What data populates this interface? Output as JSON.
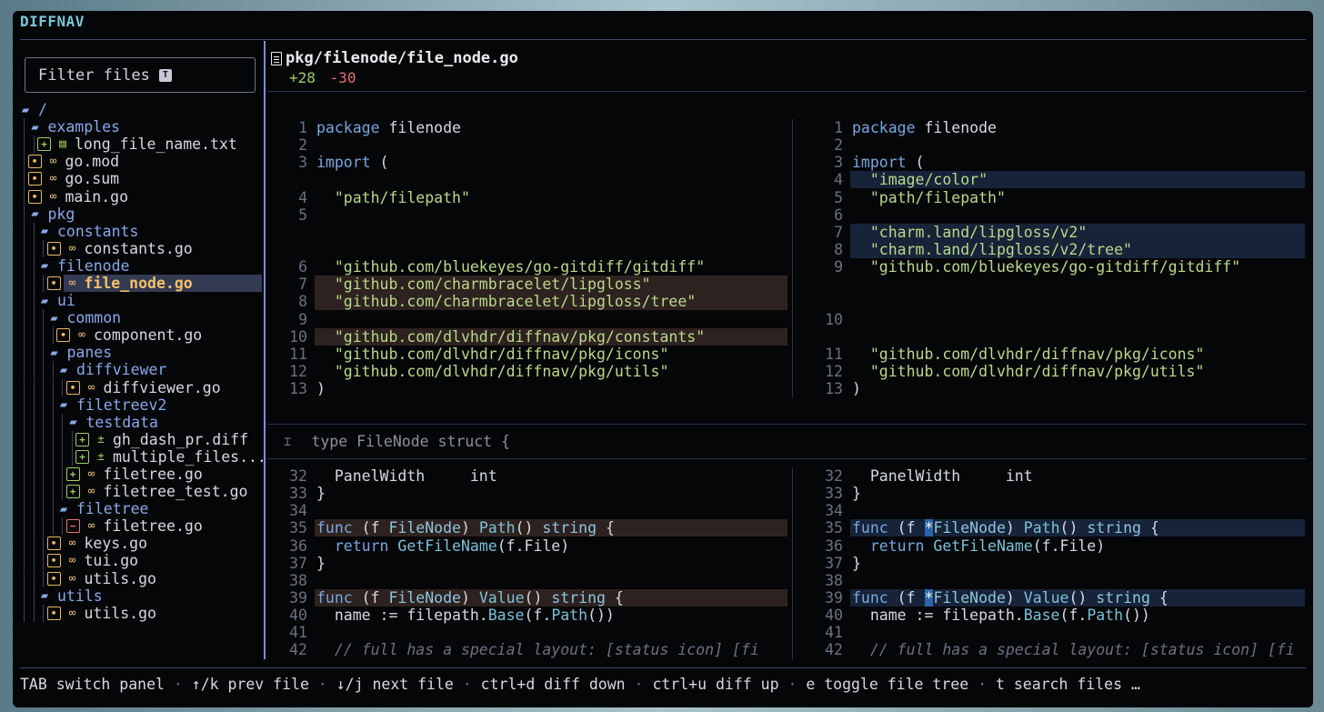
{
  "app": {
    "title": "DIFFNAV"
  },
  "sidebar": {
    "filter_label": "Filter files",
    "filter_key": "T",
    "tree": [
      {
        "depth": 0,
        "kind": "dir",
        "name": "/"
      },
      {
        "depth": 1,
        "kind": "dir",
        "name": "examples"
      },
      {
        "depth": 2,
        "kind": "file",
        "status": "add",
        "ftype": "txt",
        "name": "long_file_name.txt"
      },
      {
        "depth": 1,
        "kind": "file",
        "status": "mod",
        "ftype": "go",
        "name": "go.mod"
      },
      {
        "depth": 1,
        "kind": "file",
        "status": "mod",
        "ftype": "go",
        "name": "go.sum"
      },
      {
        "depth": 1,
        "kind": "file",
        "status": "mod",
        "ftype": "go",
        "name": "main.go"
      },
      {
        "depth": 1,
        "kind": "dir",
        "name": "pkg"
      },
      {
        "depth": 2,
        "kind": "dir",
        "name": "constants"
      },
      {
        "depth": 3,
        "kind": "file",
        "status": "mod",
        "ftype": "go",
        "name": "constants.go"
      },
      {
        "depth": 2,
        "kind": "dir",
        "name": "filenode"
      },
      {
        "depth": 3,
        "kind": "file",
        "status": "mod",
        "ftype": "go",
        "name": "file_node.go",
        "selected": true
      },
      {
        "depth": 2,
        "kind": "dir",
        "name": "ui"
      },
      {
        "depth": 3,
        "kind": "dir",
        "name": "common"
      },
      {
        "depth": 4,
        "kind": "file",
        "status": "mod",
        "ftype": "go",
        "name": "component.go"
      },
      {
        "depth": 3,
        "kind": "dir",
        "name": "panes"
      },
      {
        "depth": 4,
        "kind": "dir",
        "name": "diffviewer"
      },
      {
        "depth": 5,
        "kind": "file",
        "status": "mod",
        "ftype": "go",
        "name": "diffviewer.go"
      },
      {
        "depth": 4,
        "kind": "dir",
        "name": "filetreev2"
      },
      {
        "depth": 5,
        "kind": "dir",
        "name": "testdata"
      },
      {
        "depth": 6,
        "kind": "file",
        "status": "add",
        "ftype": "diff",
        "name": "gh_dash_pr.diff"
      },
      {
        "depth": 6,
        "kind": "file",
        "status": "add",
        "ftype": "diff",
        "name": "multiple_files..."
      },
      {
        "depth": 5,
        "kind": "file",
        "status": "add",
        "ftype": "go",
        "name": "filetree.go"
      },
      {
        "depth": 5,
        "kind": "file",
        "status": "add",
        "ftype": "go",
        "name": "filetree_test.go"
      },
      {
        "depth": 4,
        "kind": "dir",
        "name": "filetree"
      },
      {
        "depth": 5,
        "kind": "file",
        "status": "del",
        "ftype": "go",
        "name": "filetree.go"
      },
      {
        "depth": 3,
        "kind": "file",
        "status": "mod",
        "ftype": "go",
        "name": "keys.go"
      },
      {
        "depth": 3,
        "kind": "file",
        "status": "mod",
        "ftype": "go",
        "name": "tui.go"
      },
      {
        "depth": 3,
        "kind": "file",
        "status": "mod",
        "ftype": "go",
        "name": "utils.go"
      },
      {
        "depth": 2,
        "kind": "dir",
        "name": "utils"
      },
      {
        "depth": 3,
        "kind": "file",
        "status": "mod",
        "ftype": "go",
        "name": "utils.go"
      }
    ]
  },
  "file_header": {
    "path": "pkg/filenode/file_node.go",
    "additions": "+28",
    "deletions": "-30"
  },
  "hunk1": {
    "left": [
      {
        "n": "1",
        "t": [
          [
            "kw",
            "package"
          ],
          [
            "txt",
            " filenode"
          ]
        ]
      },
      {
        "n": "2",
        "t": []
      },
      {
        "n": "3",
        "t": [
          [
            "kw",
            "import"
          ],
          [
            "txt",
            " ("
          ]
        ]
      },
      {
        "n": "",
        "t": []
      },
      {
        "n": "4",
        "t": [
          [
            "str",
            "  \"path/filepath\""
          ]
        ]
      },
      {
        "n": "5",
        "t": []
      },
      {
        "n": "",
        "t": []
      },
      {
        "n": "",
        "t": []
      },
      {
        "n": "6",
        "t": [
          [
            "str",
            "  \"github.com/bluekeyes/go-gitdiff/gitdiff\""
          ]
        ]
      },
      {
        "n": "7",
        "bg": "del",
        "t": [
          [
            "str",
            "  \"github.com/charmbracelet/lipgloss\""
          ]
        ]
      },
      {
        "n": "8",
        "bg": "del",
        "t": [
          [
            "str",
            "  \"github.com/charmbracelet/lipgloss/tree\""
          ]
        ]
      },
      {
        "n": "9",
        "t": []
      },
      {
        "n": "10",
        "bg": "del",
        "t": [
          [
            "str",
            "  \"github.com/dlvhdr/diffnav/pkg/constants\""
          ]
        ]
      },
      {
        "n": "11",
        "t": [
          [
            "str",
            "  \"github.com/dlvhdr/diffnav/pkg/icons\""
          ]
        ]
      },
      {
        "n": "12",
        "t": [
          [
            "str",
            "  \"github.com/dlvhdr/diffnav/pkg/utils\""
          ]
        ]
      },
      {
        "n": "13",
        "t": [
          [
            "txt",
            ")"
          ]
        ]
      }
    ],
    "right": [
      {
        "n": "1",
        "t": [
          [
            "kw",
            "package"
          ],
          [
            "txt",
            " filenode"
          ]
        ]
      },
      {
        "n": "2",
        "t": []
      },
      {
        "n": "3",
        "t": [
          [
            "kw",
            "import"
          ],
          [
            "txt",
            " ("
          ]
        ]
      },
      {
        "n": "4",
        "bg": "add",
        "t": [
          [
            "str",
            "  \"image/color\""
          ]
        ]
      },
      {
        "n": "5",
        "t": [
          [
            "str",
            "  \"path/filepath\""
          ]
        ]
      },
      {
        "n": "6",
        "t": []
      },
      {
        "n": "7",
        "bg": "add",
        "t": [
          [
            "str",
            "  \"charm.land/lipgloss/v2\""
          ]
        ]
      },
      {
        "n": "8",
        "bg": "add",
        "t": [
          [
            "str",
            "  \"charm.land/lipgloss/v2/tree\""
          ]
        ]
      },
      {
        "n": "9",
        "t": [
          [
            "str",
            "  \"github.com/bluekeyes/go-gitdiff/gitdiff\""
          ]
        ]
      },
      {
        "n": "",
        "t": []
      },
      {
        "n": "",
        "t": []
      },
      {
        "n": "10",
        "t": []
      },
      {
        "n": "",
        "t": []
      },
      {
        "n": "11",
        "t": [
          [
            "str",
            "  \"github.com/dlvhdr/diffnav/pkg/icons\""
          ]
        ]
      },
      {
        "n": "12",
        "t": [
          [
            "str",
            "  \"github.com/dlvhdr/diffnav/pkg/utils\""
          ]
        ]
      },
      {
        "n": "13",
        "t": [
          [
            "txt",
            ")"
          ]
        ]
      }
    ]
  },
  "hunk_header": {
    "icon": "⌶",
    "text": "type FileNode struct {"
  },
  "hunk2": {
    "left": [
      {
        "n": "32",
        "t": [
          [
            "txt",
            "  PanelWidth     int"
          ]
        ]
      },
      {
        "n": "33",
        "t": [
          [
            "txt",
            "}"
          ]
        ]
      },
      {
        "n": "34",
        "t": []
      },
      {
        "n": "35",
        "bg": "del",
        "t": [
          [
            "kw",
            "func"
          ],
          [
            "txt",
            " (f "
          ],
          [
            "ty",
            "FileNode"
          ],
          [
            "txt",
            ") "
          ],
          [
            "fn",
            "Path"
          ],
          [
            "txt",
            "() "
          ],
          [
            "ty",
            "string"
          ],
          [
            "txt",
            " {"
          ]
        ]
      },
      {
        "n": "36",
        "t": [
          [
            "txt",
            "  "
          ],
          [
            "kw",
            "return"
          ],
          [
            "txt",
            " "
          ],
          [
            "fn",
            "GetFileName"
          ],
          [
            "txt",
            "(f.File)"
          ]
        ]
      },
      {
        "n": "37",
        "t": [
          [
            "txt",
            "}"
          ]
        ]
      },
      {
        "n": "38",
        "t": []
      },
      {
        "n": "39",
        "bg": "del",
        "t": [
          [
            "kw",
            "func"
          ],
          [
            "txt",
            " (f "
          ],
          [
            "ty",
            "FileNode"
          ],
          [
            "txt",
            ") "
          ],
          [
            "fn",
            "Value"
          ],
          [
            "txt",
            "() "
          ],
          [
            "ty",
            "string"
          ],
          [
            "txt",
            " {"
          ]
        ]
      },
      {
        "n": "40",
        "t": [
          [
            "txt",
            "  name := filepath."
          ],
          [
            "fn",
            "Base"
          ],
          [
            "txt",
            "(f."
          ],
          [
            "fn",
            "Path"
          ],
          [
            "txt",
            "())"
          ]
        ]
      },
      {
        "n": "41",
        "t": []
      },
      {
        "n": "42",
        "t": [
          [
            "cm",
            "  // full has a special layout: [status icon] [fi"
          ]
        ]
      }
    ],
    "right": [
      {
        "n": "32",
        "t": [
          [
            "txt",
            "  PanelWidth     int"
          ]
        ]
      },
      {
        "n": "33",
        "t": [
          [
            "txt",
            "}"
          ]
        ]
      },
      {
        "n": "34",
        "t": []
      },
      {
        "n": "35",
        "bg": "add",
        "t": [
          [
            "kw",
            "func"
          ],
          [
            "txt",
            " (f "
          ],
          [
            "hl",
            "*"
          ],
          [
            "ty",
            "FileNode"
          ],
          [
            "txt",
            ") "
          ],
          [
            "fn",
            "Path"
          ],
          [
            "txt",
            "() "
          ],
          [
            "ty",
            "string"
          ],
          [
            "txt",
            " {"
          ]
        ]
      },
      {
        "n": "36",
        "t": [
          [
            "txt",
            "  "
          ],
          [
            "kw",
            "return"
          ],
          [
            "txt",
            " "
          ],
          [
            "fn",
            "GetFileName"
          ],
          [
            "txt",
            "(f.File)"
          ]
        ]
      },
      {
        "n": "37",
        "t": [
          [
            "txt",
            "}"
          ]
        ]
      },
      {
        "n": "38",
        "t": []
      },
      {
        "n": "39",
        "bg": "add",
        "t": [
          [
            "kw",
            "func"
          ],
          [
            "txt",
            " (f "
          ],
          [
            "hl",
            "*"
          ],
          [
            "ty",
            "FileNode"
          ],
          [
            "txt",
            ") "
          ],
          [
            "fn",
            "Value"
          ],
          [
            "txt",
            "() "
          ],
          [
            "ty",
            "string"
          ],
          [
            "txt",
            " {"
          ]
        ]
      },
      {
        "n": "40",
        "t": [
          [
            "txt",
            "  name := filepath."
          ],
          [
            "fn",
            "Base"
          ],
          [
            "txt",
            "(f."
          ],
          [
            "fn",
            "Path"
          ],
          [
            "txt",
            "())"
          ]
        ]
      },
      {
        "n": "41",
        "t": []
      },
      {
        "n": "42",
        "t": [
          [
            "cm",
            "  // full has a special layout: [status icon] [fi"
          ]
        ]
      }
    ]
  },
  "footer": {
    "separator": " · ",
    "hints": [
      "TAB switch panel",
      "↑/k prev file",
      "↓/j next file",
      "ctrl+d diff down",
      "ctrl+u diff up",
      "e toggle file tree",
      "t search files …"
    ]
  },
  "colors": {
    "accent": "#7b8cde",
    "add": "#9ccc65",
    "del": "#e57373",
    "mod": "#e8b860"
  }
}
